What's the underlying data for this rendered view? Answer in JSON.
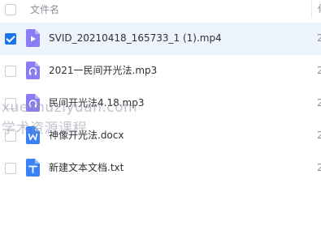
{
  "header": {
    "name_label": "文件名",
    "col2_clip": "修"
  },
  "files": [
    {
      "name": "SVID_20210418_165733_1 (1).mp4",
      "type": "video",
      "icon_color": "#8b7cf6",
      "selected": true,
      "date_clip": "2"
    },
    {
      "name": "2021一民间开光法.mp3",
      "type": "audio",
      "icon_color": "#8b7cf6",
      "selected": false,
      "date_clip": "2"
    },
    {
      "name": "民间开光法4.18.mp3",
      "type": "audio",
      "icon_color": "#8b7cf6",
      "selected": false,
      "date_clip": "2"
    },
    {
      "name": "神像开光法.docx",
      "type": "word",
      "icon_color": "#3b82f6",
      "selected": false,
      "date_clip": "2"
    },
    {
      "name": "新建文本文档.txt",
      "type": "text",
      "icon_color": "#3b82f6",
      "selected": false,
      "date_clip": "2"
    }
  ],
  "watermark": {
    "line1": "xueshuziyuan.com",
    "line2": "学术资源课程"
  }
}
